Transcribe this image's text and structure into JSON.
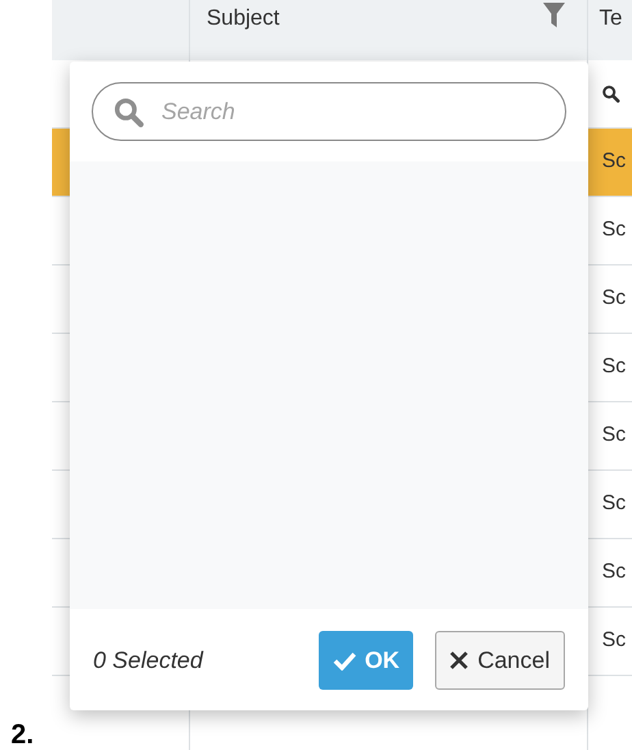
{
  "table": {
    "columns": [
      {
        "label": "Subject",
        "filter": true
      },
      {
        "label": "Te"
      }
    ],
    "rows": [
      {
        "column_3": "Sc",
        "selected": true
      },
      {
        "column_3": "Sc",
        "selected": false
      },
      {
        "column_3": "Sc",
        "selected": false
      },
      {
        "column_3": "Sc",
        "selected": false
      },
      {
        "column_3": "Sc",
        "selected": false
      },
      {
        "column_3": "Sc",
        "selected": false
      },
      {
        "column_3": "Sc",
        "selected": false
      },
      {
        "column_3": "Sc",
        "selected": false
      }
    ]
  },
  "filter_popup": {
    "search": {
      "placeholder": "Search"
    },
    "selected_count": "0 Selected",
    "buttons": [
      {
        "kind": "ok",
        "label": "OK"
      },
      {
        "kind": "cancel",
        "label": "Cancel"
      }
    ]
  },
  "footnote": "2."
}
